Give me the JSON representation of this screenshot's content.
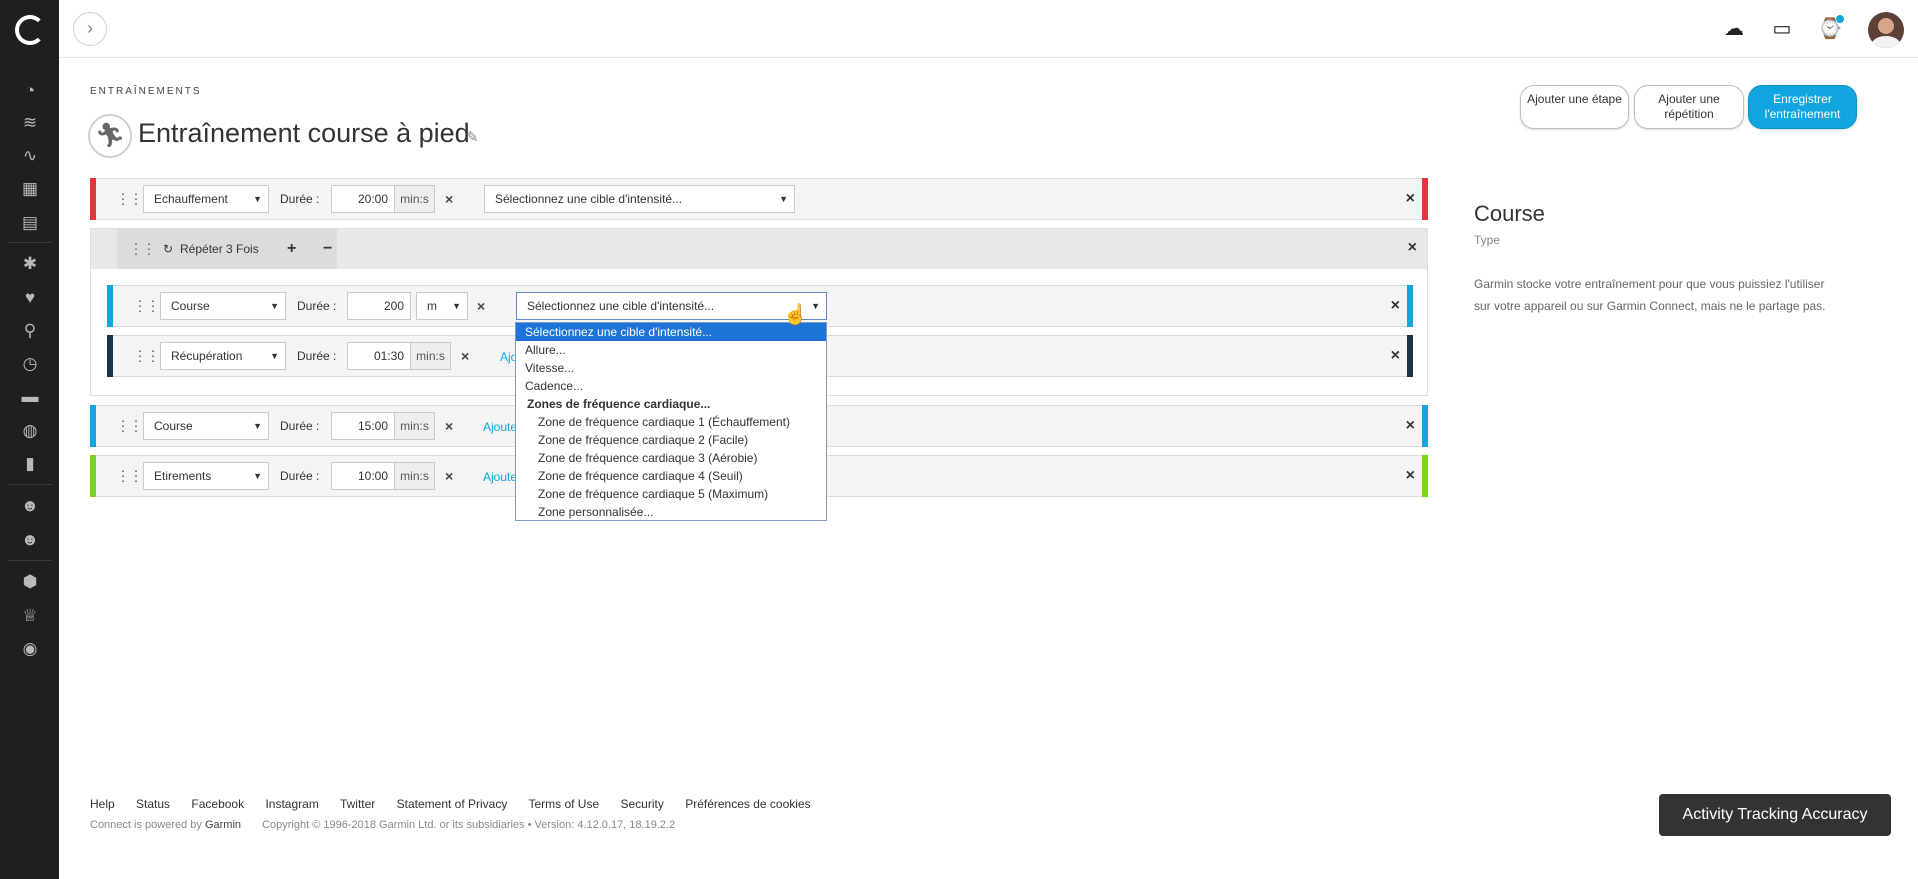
{
  "header": {
    "breadcrumb": "ENTRAÎNEMENTS",
    "title": "Entraînement course à pied",
    "buttons": {
      "add_step": "Ajouter une étape",
      "add_repeat": "Ajouter une répétition",
      "save": "Enregistrer l'entraînement"
    }
  },
  "common": {
    "duration_label": "Durée :",
    "add_link": "Ajoute",
    "add_link_short": "Ajo"
  },
  "steps": {
    "warmup": {
      "type": "Echauffement",
      "duration": "20:00",
      "unit": "min:s",
      "target": "Sélectionnez une cible d'intensité..."
    },
    "repeat": {
      "label": "Répéter 3 Fois"
    },
    "run1": {
      "type": "Course",
      "duration": "200",
      "unit": "m",
      "target": "Sélectionnez une cible d'intensité..."
    },
    "recovery": {
      "type": "Récupération",
      "duration": "01:30",
      "unit": "min:s"
    },
    "run2": {
      "type": "Course",
      "duration": "15:00",
      "unit": "min:s"
    },
    "stretch": {
      "type": "Etirements",
      "duration": "10:00",
      "unit": "min:s"
    }
  },
  "dropdown": {
    "options": [
      "Sélectionnez une cible d'intensité...",
      "Allure...",
      "Vitesse...",
      "Cadence...",
      "Zones de fréquence cardiaque...",
      "Zone de fréquence cardiaque 1 (Échauffement)",
      "Zone de fréquence cardiaque 2 (Facile)",
      "Zone de fréquence cardiaque 3 (Aérobie)",
      "Zone de fréquence cardiaque 4 (Seuil)",
      "Zone de fréquence cardiaque 5 (Maximum)",
      "Zone personnalisée..."
    ]
  },
  "sidepanel": {
    "title": "Course",
    "subtitle": "Type",
    "description": "Garmin stocke votre entraînement pour que vous puissiez l'utiliser sur votre appareil ou sur Garmin Connect, mais ne le partage pas."
  },
  "footer": {
    "links": [
      "Help",
      "Status",
      "Facebook",
      "Instagram",
      "Twitter",
      "Statement of Privacy",
      "Terms of Use",
      "Security",
      "Préférences de cookies"
    ],
    "powered": "Connect is powered by",
    "brand": "Garmin",
    "copyright": "Copyright © 1996-2018 Garmin Ltd. or its subsidiaries • Version: 4.12.0.17, 18.19.2.2",
    "accuracy_button": "Activity Tracking Accuracy"
  },
  "colors": {
    "warmup": "#e8343f",
    "run": "#12a5e0",
    "recovery": "#1b3347",
    "stretch": "#7ed321",
    "accent": "#12a5e0"
  }
}
